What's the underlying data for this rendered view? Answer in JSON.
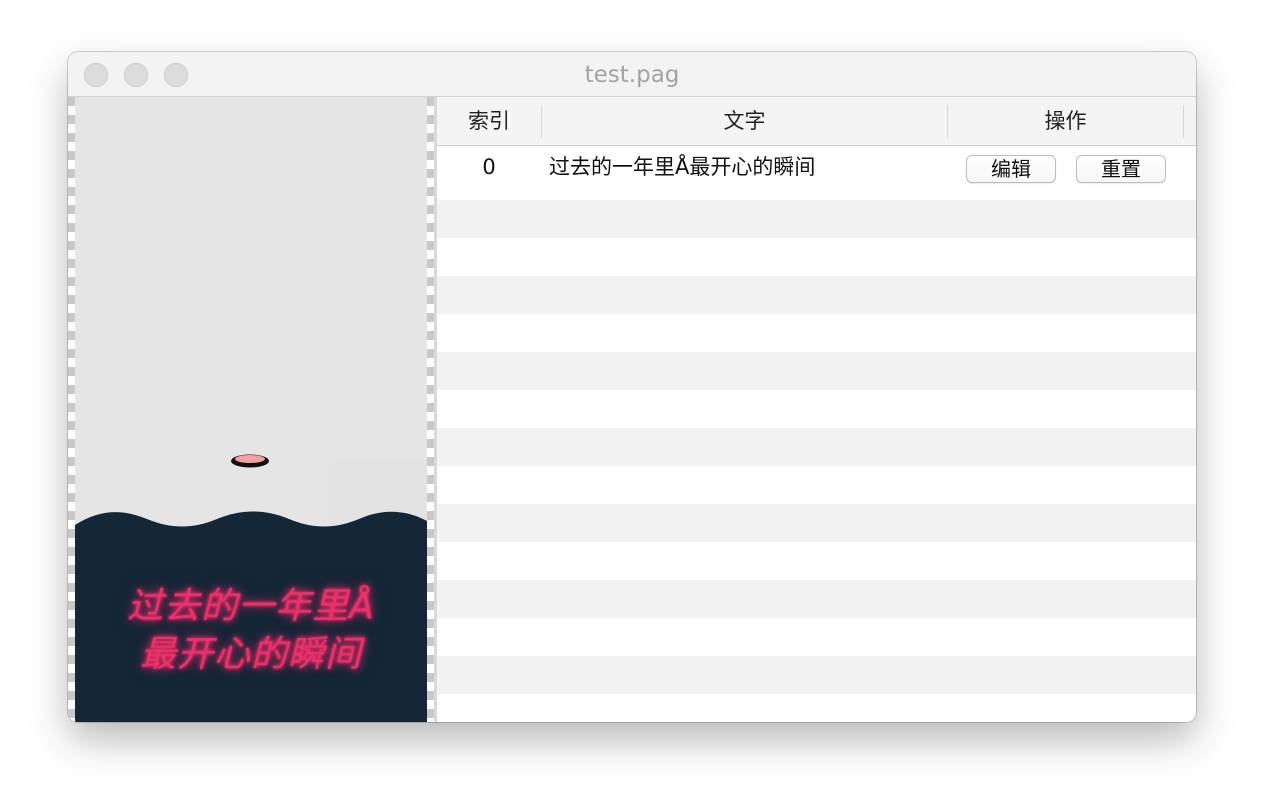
{
  "window": {
    "title": "test.pag"
  },
  "preview": {
    "text_line1": "过去的一年里Å",
    "text_line2": "最开心的瞬间",
    "colors": {
      "background": "#e5e5e5",
      "wave": "#132737",
      "text": "#e8326a",
      "ball": "#f2a0a0"
    }
  },
  "table": {
    "columns": [
      "索引",
      "文字",
      "操作"
    ],
    "rows": [
      {
        "index": "0",
        "text": "过去的一年里Å最开心的瞬间",
        "actions": [
          "编辑",
          "重置"
        ]
      }
    ]
  }
}
